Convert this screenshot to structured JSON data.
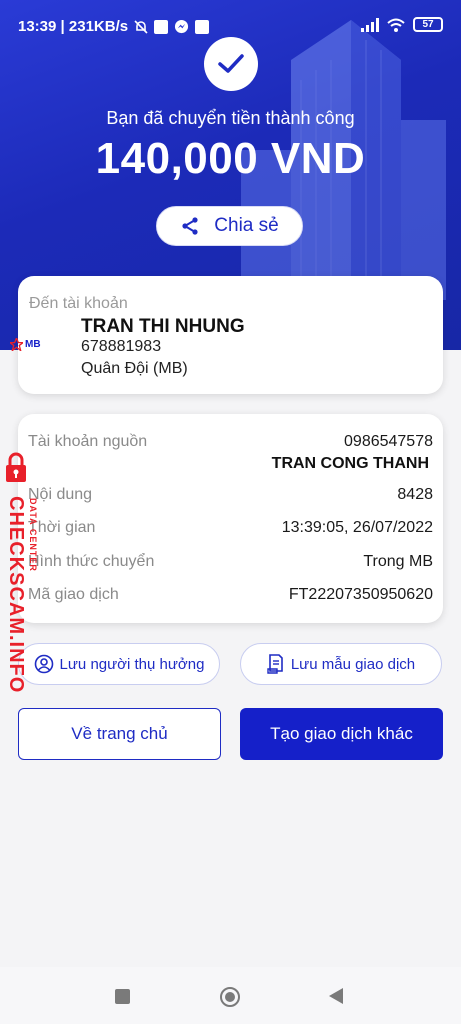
{
  "status_bar": {
    "time_speed": "13:39 | 231KB/s",
    "battery": "57"
  },
  "result": {
    "success_text": "Bạn đã chuyển tiền thành công",
    "amount": "140,000 VND",
    "share_label": "Chia sẻ"
  },
  "destination": {
    "label": "Đến tài khoản",
    "bank_logo_text": "MB",
    "name": "TRAN THI NHUNG",
    "account": "678881983",
    "bank": "Quân Đội (MB)"
  },
  "details": {
    "source_label": "Tài khoản nguồn",
    "source_account": "0986547578",
    "source_name": "TRAN CONG THANH",
    "content_label": "Nội dung",
    "content_value": "8428",
    "time_label": "Thời gian",
    "time_value": "13:39:05, 26/07/2022",
    "method_label": "Hình thức chuyển",
    "method_value": "Trong MB",
    "txn_label": "Mã giao dịch",
    "txn_value": "FT22207350950620"
  },
  "actions": {
    "save_beneficiary": "Lưu người thụ hưởng",
    "save_template": "Lưu mẫu giao dịch",
    "home": "Về trang chủ",
    "new_transaction": "Tạo giao dịch khác"
  },
  "watermark": {
    "main": "CHECKSCAM.INFO",
    "sub": "DATA CENTER"
  },
  "colors": {
    "brand_blue": "#1520c9",
    "hero_blue": "#2a3bd6",
    "watermark_red": "#e8202a"
  }
}
